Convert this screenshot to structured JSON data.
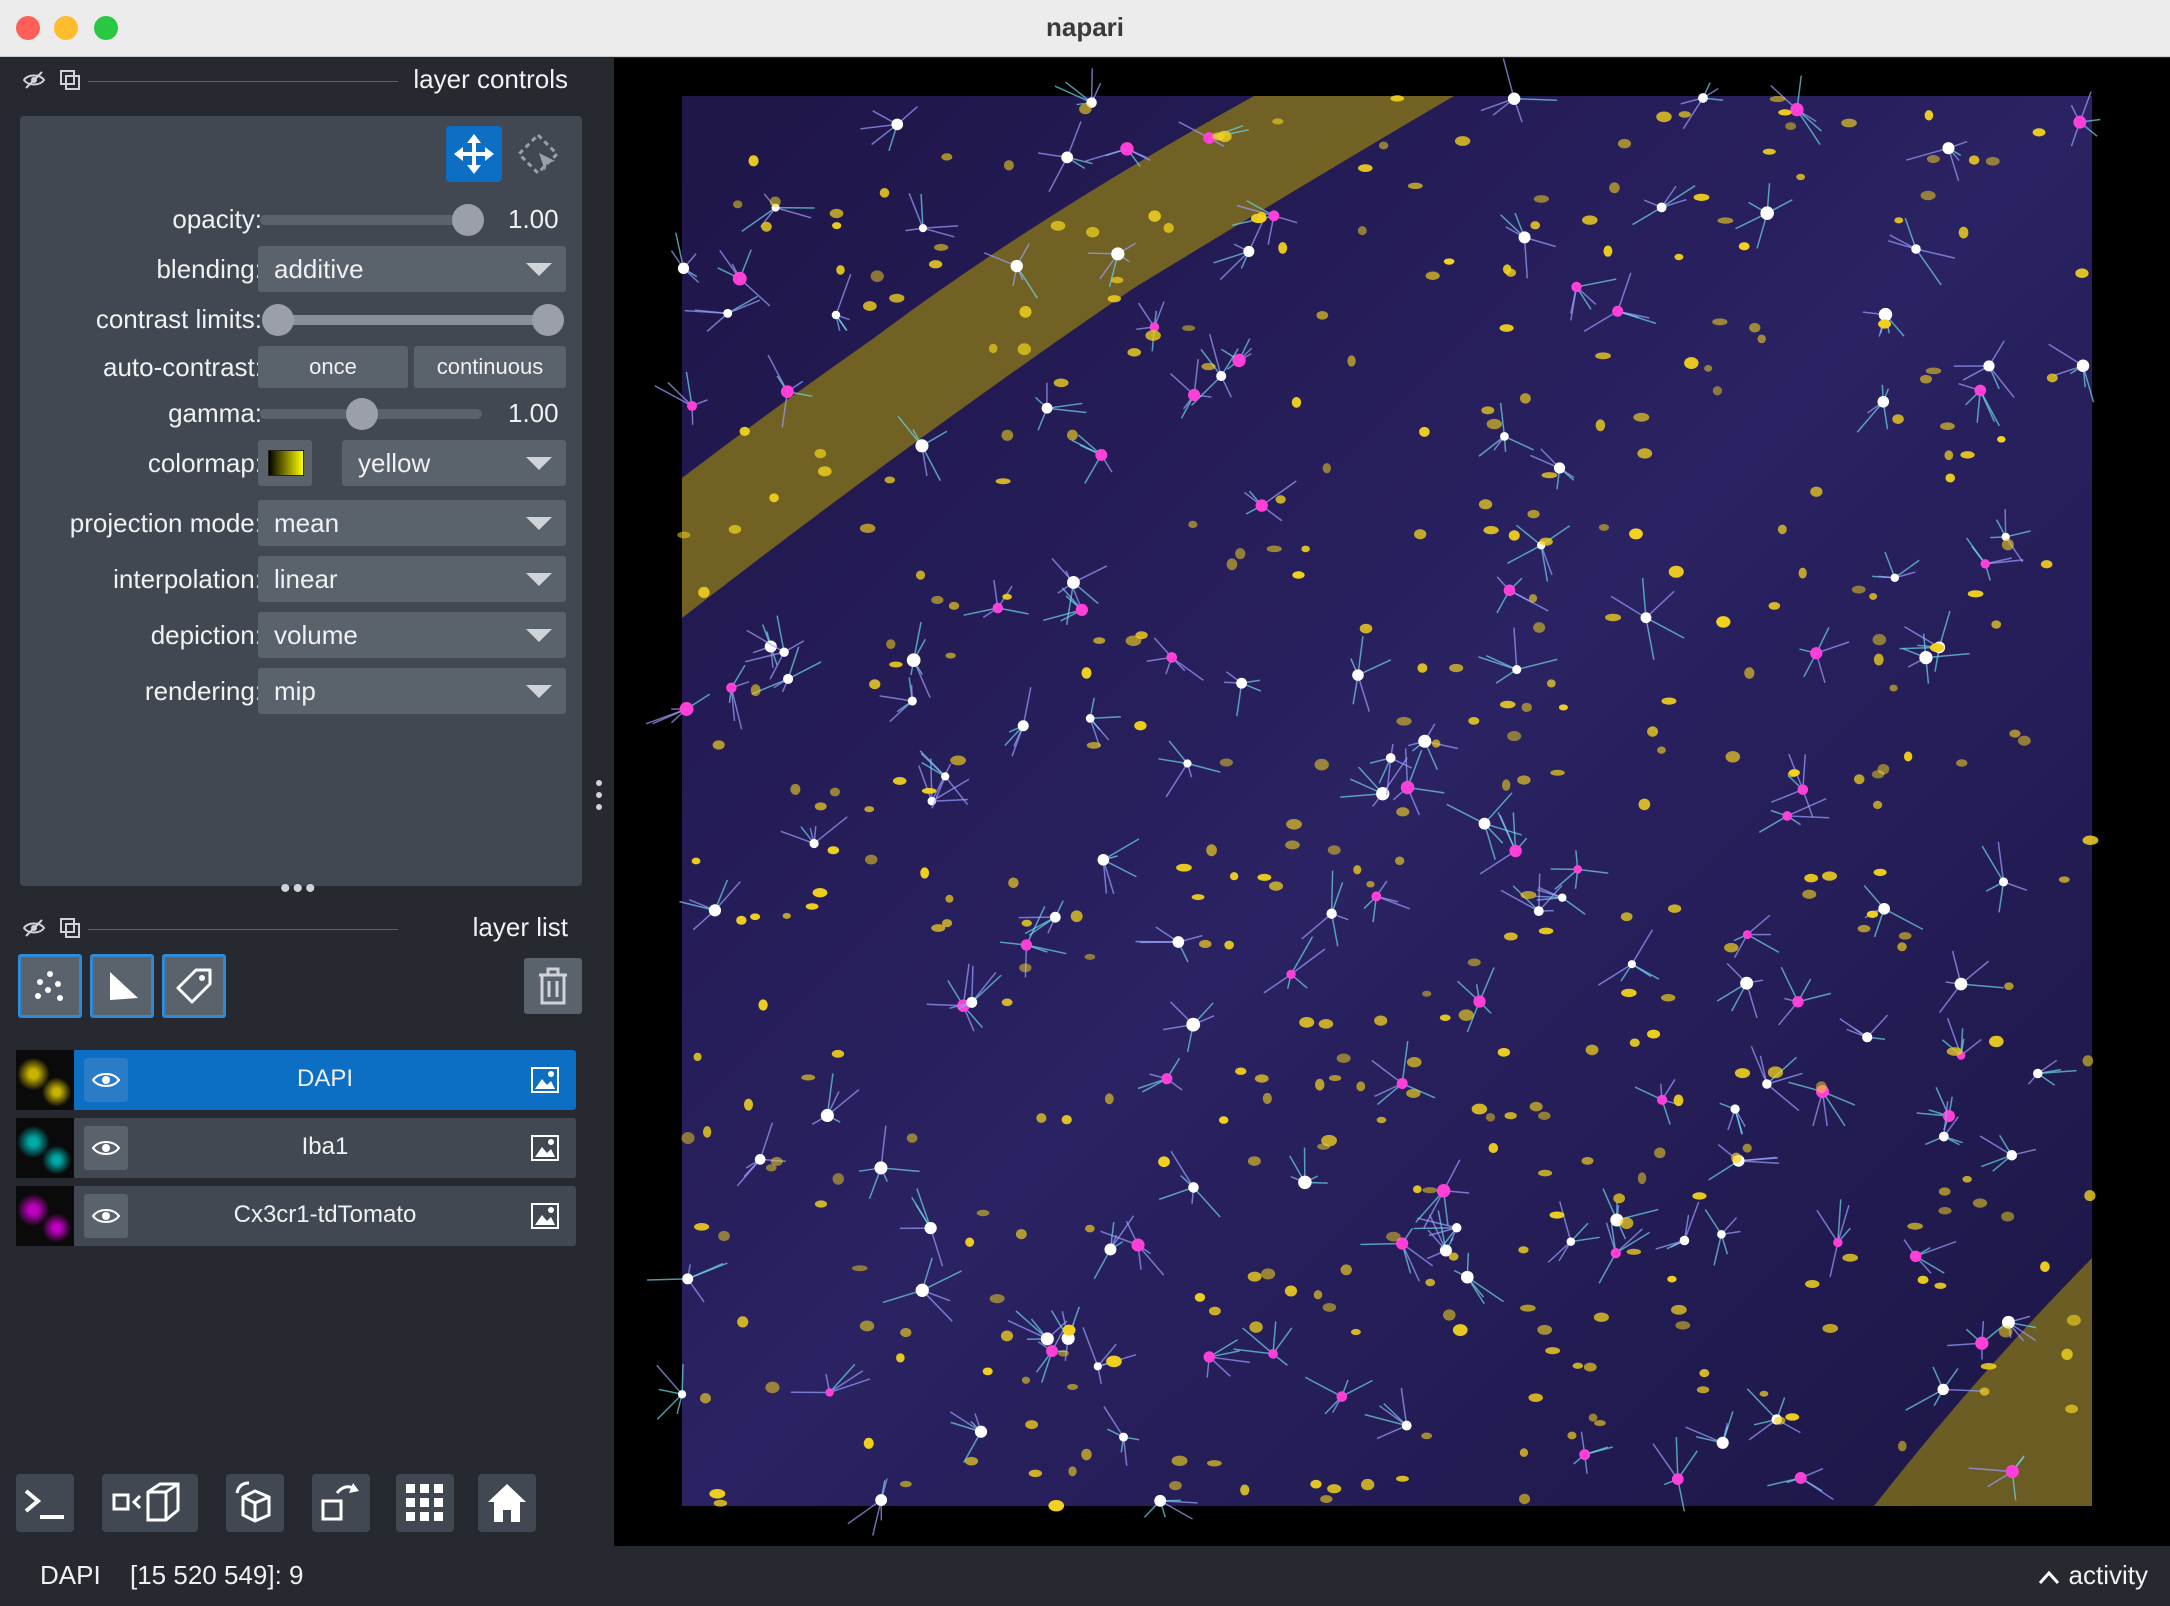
{
  "window": {
    "title": "napari"
  },
  "controls_header": {
    "title": "layer controls"
  },
  "controls": {
    "opacity": {
      "label": "opacity:",
      "value": "1.00",
      "fraction": 1.0
    },
    "blending": {
      "label": "blending:",
      "value": "additive"
    },
    "contrast_limits": {
      "label": "contrast limits:",
      "low": 0.0,
      "high": 1.0
    },
    "auto_contrast": {
      "label": "auto-contrast:",
      "once": "once",
      "continuous": "continuous"
    },
    "gamma": {
      "label": "gamma:",
      "value": "1.00",
      "fraction": 0.45
    },
    "colormap": {
      "label": "colormap:",
      "value": "yellow"
    },
    "projection_mode": {
      "label": "projection mode:",
      "value": "mean"
    },
    "interpolation": {
      "label": "interpolation:",
      "value": "linear"
    },
    "depiction": {
      "label": "depiction:",
      "value": "volume"
    },
    "rendering": {
      "label": "rendering:",
      "value": "mip"
    }
  },
  "layerlist_header": {
    "title": "layer list"
  },
  "layers": [
    {
      "name": "DAPI",
      "selected": true,
      "thumb_color": "#c8b400"
    },
    {
      "name": "Iba1",
      "selected": false,
      "thumb_color": "#00a8a8"
    },
    {
      "name": "Cx3cr1-tdTomato",
      "selected": false,
      "thumb_color": "#c000c0"
    }
  ],
  "status": {
    "layer": "DAPI",
    "coordinates": "[15 520 549]: 9",
    "activity": "activity"
  },
  "colors": {
    "background": "#262930",
    "panel": "#414851",
    "control": "#5a626c",
    "accent": "#0d6fc4",
    "highlight": "#2e8ad6"
  }
}
